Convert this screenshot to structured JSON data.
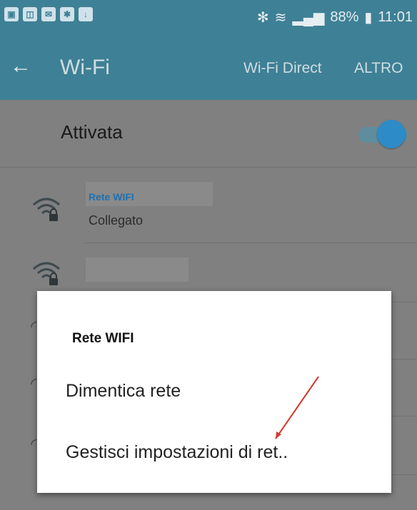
{
  "status_bar": {
    "battery": "88%",
    "time": "11:01"
  },
  "app_bar": {
    "back_icon": "arrow-left-icon",
    "title": "Wi-Fi",
    "direct": "Wi-Fi Direct",
    "more": "ALTRO"
  },
  "wifi_toggle": {
    "label": "Attivata",
    "state": "on"
  },
  "networks": [
    {
      "name": "Rete WIFI",
      "status": "Collegato"
    }
  ],
  "dialog": {
    "title": "Rete WIFI",
    "items": [
      {
        "label": "Dimentica rete"
      },
      {
        "label": "Gestisci impostazioni di ret.."
      }
    ]
  },
  "colors": {
    "accent": "#3e8095",
    "switch": "#2d8bc8",
    "annotation": "#d23a2f"
  }
}
